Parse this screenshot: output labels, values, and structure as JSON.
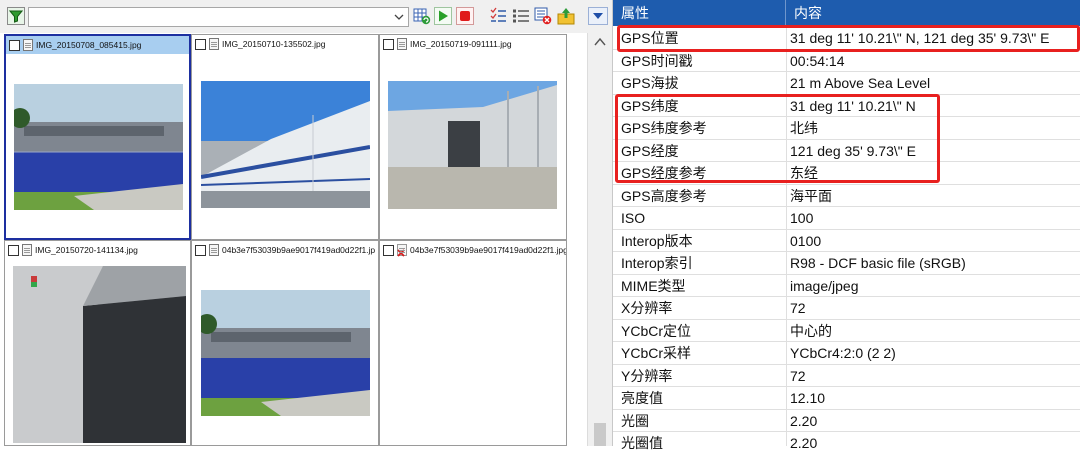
{
  "toolbar": {
    "filter_text": "",
    "buttons": [
      "funnel-icon",
      "dropdown-icon",
      "refresh-icon",
      "play-icon",
      "stop-icon",
      "list-check-icon",
      "list-icon",
      "remove-icon",
      "export-icon",
      "menu-arrow-icon"
    ]
  },
  "thumbnails": [
    {
      "name": "IMG_20150708_085415.jpg",
      "selected": true
    },
    {
      "name": "IMG_20150710-135502.jpg",
      "selected": false
    },
    {
      "name": "IMG_20150719-091111.jpg",
      "selected": false
    },
    {
      "name": "IMG_20150720-141134.jpg",
      "selected": false
    },
    {
      "name": "04b3e7f53039b9ae9017f419ad0d22f1.jp",
      "selected": false
    },
    {
      "name": "04b3e7f53039b9ae9017f419ad0d22f1.jpg",
      "selected": false
    }
  ],
  "properties": {
    "header": {
      "key": "属性",
      "value": "内容"
    },
    "rows": [
      {
        "key": "GPS位置",
        "value": "31 deg 11' 10.21\\\" N, 121 deg 35' 9.73\\\" E"
      },
      {
        "key": "GPS时间戳",
        "value": "00:54:14"
      },
      {
        "key": "GPS海拔",
        "value": "21 m Above Sea Level"
      },
      {
        "key": "GPS纬度",
        "value": "31 deg 11' 10.21\\\" N"
      },
      {
        "key": "GPS纬度参考",
        "value": "北纬"
      },
      {
        "key": "GPS经度",
        "value": "121 deg 35' 9.73\\\" E"
      },
      {
        "key": "GPS经度参考",
        "value": "东经"
      },
      {
        "key": "GPS高度参考",
        "value": "海平面"
      },
      {
        "key": "ISO",
        "value": "100"
      },
      {
        "key": "Interop版本",
        "value": "0100"
      },
      {
        "key": "Interop索引",
        "value": "R98 - DCF basic file (sRGB)"
      },
      {
        "key": "MIME类型",
        "value": "image/jpeg"
      },
      {
        "key": "X分辨率",
        "value": "72"
      },
      {
        "key": "YCbCr定位",
        "value": "中心的"
      },
      {
        "key": "YCbCr采样",
        "value": "YCbCr4:2:0 (2 2)"
      },
      {
        "key": "Y分辨率",
        "value": "72"
      },
      {
        "key": "亮度值",
        "value": "12.10"
      },
      {
        "key": "光圈",
        "value": "2.20"
      },
      {
        "key": "光圈值",
        "value": "2.20"
      }
    ]
  },
  "colors": {
    "header_bg": "#1e5cae",
    "highlight": "#e8201f",
    "selection": "#1d2fa0"
  }
}
